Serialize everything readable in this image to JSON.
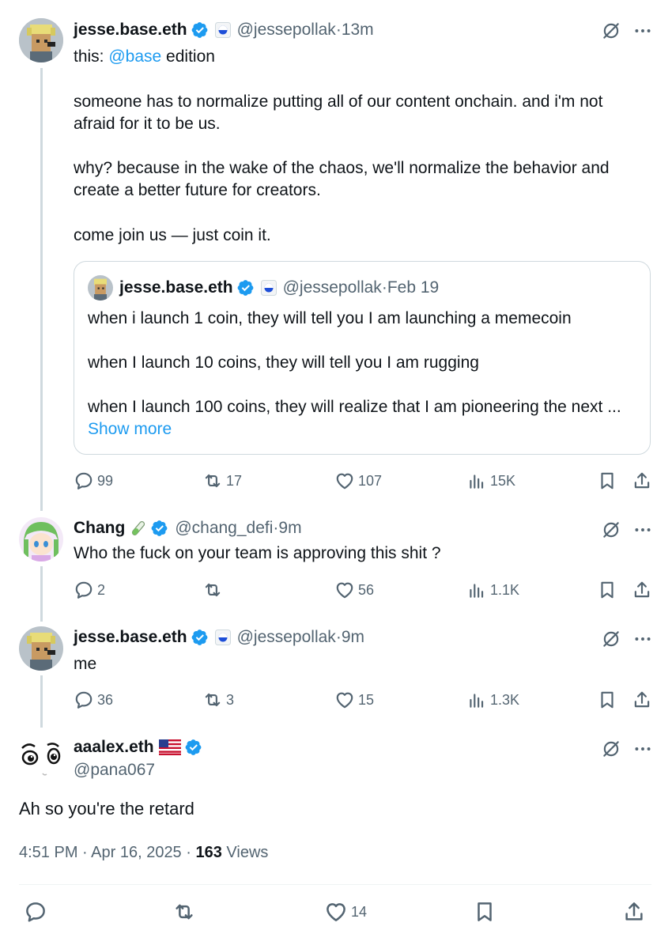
{
  "tweets": [
    {
      "name": "jesse.base.eth",
      "handle": "@jessepollak",
      "time": "13m",
      "intro_prefix": "this: ",
      "intro_mention": "@base",
      "intro_suffix": " edition",
      "paragraphs": [
        "someone has to normalize putting all of our content onchain. and i'm not afraid for it to be us.",
        "why? because in the wake of the chaos, we'll normalize the behavior and create a better future for creators.",
        "come join us — just coin it."
      ],
      "quote": {
        "name": "jesse.base.eth",
        "handle": "@jessepollak",
        "time": "Feb 19",
        "lines": [
          "when i launch 1 coin, they will tell you I am launching a memecoin",
          "when I launch 10 coins, they will tell you I am rugging",
          "when I launch 100 coins, they will realize that I am pioneering the next ..."
        ],
        "show_more": "Show more"
      },
      "replies": "99",
      "reposts": "17",
      "likes": "107",
      "views": "15K"
    },
    {
      "name": "Chang",
      "handle": "@chang_defi",
      "time": "9m",
      "text": "Who the fuck on your team is approving this shit ?",
      "replies": "2",
      "reposts": "",
      "likes": "56",
      "views": "1.1K"
    },
    {
      "name": "jesse.base.eth",
      "handle": "@jessepollak",
      "time": "9m",
      "text": "me",
      "replies": "36",
      "reposts": "3",
      "likes": "15",
      "views": "1.3K"
    }
  ],
  "main": {
    "name": "aaalex.eth",
    "handle": "@pana067",
    "text": "Ah so you're the retard",
    "time": "4:51 PM · Apr 16, 2025 · ",
    "views_count": "163",
    "views_label": " Views",
    "likes": "14"
  },
  "separator": " · ",
  "colors": {
    "accent": "#1d9bf0",
    "muted": "#536471",
    "border": "#cfd9de"
  },
  "icons": [
    "verified-badge-icon",
    "grok-icon",
    "more-icon",
    "reply-icon",
    "repost-icon",
    "like-icon",
    "views-icon",
    "bookmark-icon",
    "share-icon",
    "flag-icon"
  ]
}
